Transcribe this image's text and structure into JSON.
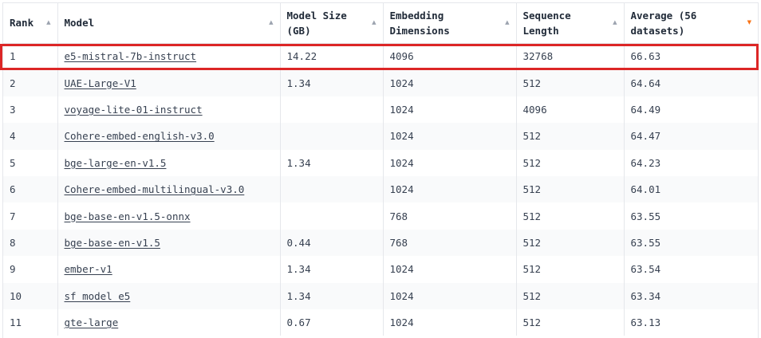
{
  "headers": {
    "rank": "Rank",
    "model": "Model",
    "size_l1": "Model Size",
    "size_l2": "(GB)",
    "emb_l1": "Embedding",
    "emb_l2": "Dimensions",
    "seq_l1": "Sequence",
    "seq_l2": "Length",
    "avg_l1": "Average (56",
    "avg_l2": "datasets)"
  },
  "icons": {
    "sort_neutral": "▲",
    "sort_active": "▼",
    "active_color": "#f97316",
    "highlight_color": "#dc2626"
  },
  "rows": [
    {
      "rank": "1",
      "model": "e5-mistral-7b-instruct",
      "size": "14.22",
      "emb": "4096",
      "seq": "32768",
      "avg": "66.63"
    },
    {
      "rank": "2",
      "model": "UAE-Large-V1",
      "size": "1.34",
      "emb": "1024",
      "seq": "512",
      "avg": "64.64"
    },
    {
      "rank": "3",
      "model": "voyage-lite-01-instruct",
      "size": "",
      "emb": "1024",
      "seq": "4096",
      "avg": "64.49"
    },
    {
      "rank": "4",
      "model": "Cohere-embed-english-v3.0",
      "size": "",
      "emb": "1024",
      "seq": "512",
      "avg": "64.47"
    },
    {
      "rank": "5",
      "model": "bge-large-en-v1.5",
      "size": "1.34",
      "emb": "1024",
      "seq": "512",
      "avg": "64.23"
    },
    {
      "rank": "6",
      "model": "Cohere-embed-multilingual-v3.0",
      "size": "",
      "emb": "1024",
      "seq": "512",
      "avg": "64.01"
    },
    {
      "rank": "7",
      "model": "bge-base-en-v1.5-onnx",
      "size": "",
      "emb": "768",
      "seq": "512",
      "avg": "63.55"
    },
    {
      "rank": "8",
      "model": "bge-base-en-v1.5",
      "size": "0.44",
      "emb": "768",
      "seq": "512",
      "avg": "63.55"
    },
    {
      "rank": "9",
      "model": "ember-v1",
      "size": "1.34",
      "emb": "1024",
      "seq": "512",
      "avg": "63.54"
    },
    {
      "rank": "10",
      "model": "sf_model_e5",
      "size": "1.34",
      "emb": "1024",
      "seq": "512",
      "avg": "63.34"
    },
    {
      "rank": "11",
      "model": "gte-large",
      "size": "0.67",
      "emb": "1024",
      "seq": "512",
      "avg": "63.13"
    }
  ]
}
